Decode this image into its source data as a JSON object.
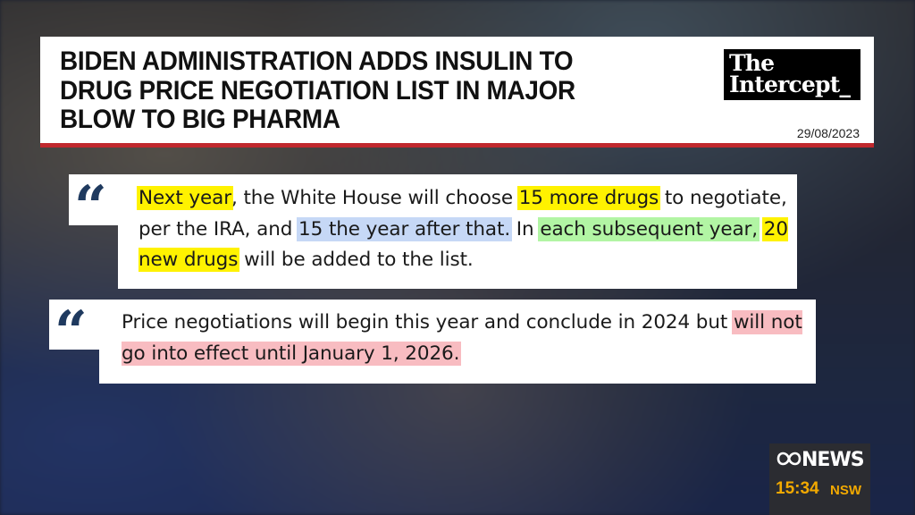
{
  "headline": {
    "title_lines": [
      "BIDEN ADMINISTRATION ADDS INSULIN TO",
      "DRUG PRICE NEGOTIATION LIST IN MAJOR",
      "BLOW TO BIG PHARMA"
    ],
    "source_line1": "The",
    "source_line2": "Intercept_",
    "date": "29/08/2023",
    "accent_color": "#c0282d"
  },
  "quotes": [
    {
      "icon": "quote-icon",
      "segments": [
        {
          "text": "Next year",
          "highlight": "yellow"
        },
        {
          "text": ", the White House will choose ",
          "highlight": null
        },
        {
          "text": "15 more drugs",
          "highlight": "yellow"
        },
        {
          "text": " to negotiate, per the IRA, and ",
          "highlight": null
        },
        {
          "text": "15 the year after that.",
          "highlight": "blue"
        },
        {
          "text": " In ",
          "highlight": null
        },
        {
          "text": "each subsequent year,",
          "highlight": "green"
        },
        {
          "text": " ",
          "highlight": null
        },
        {
          "text": "20 new drugs",
          "highlight": "yellow"
        },
        {
          "text": " will be added to the list.",
          "highlight": null
        }
      ]
    },
    {
      "icon": "quote-icon",
      "segments": [
        {
          "text": "Price negotiations will begin this year and conclude in 2024 but ",
          "highlight": null
        },
        {
          "text": "will not go into effect until January 1, 2026.",
          "highlight": "pink"
        }
      ]
    }
  ],
  "highlight_colors": {
    "yellow": "#fff200",
    "blue": "#c6d8f6",
    "green": "#b2f5a4",
    "pink": "#f8bcc1"
  },
  "broadcast": {
    "network": "NEWS",
    "time": "15:34",
    "region": "NSW",
    "accent_color": "#f2a900"
  }
}
